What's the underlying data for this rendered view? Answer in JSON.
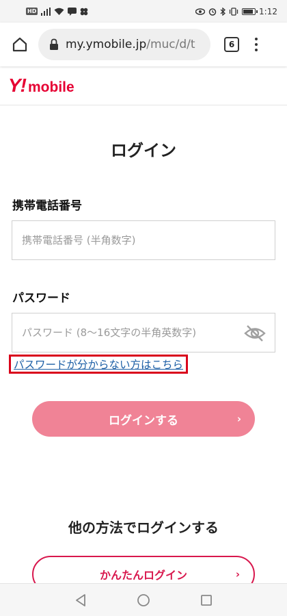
{
  "status_bar": {
    "hd": "HD",
    "time": "1:12",
    "battery_level": 0.75
  },
  "browser": {
    "url_domain": "my.ymobile.jp",
    "url_path": "/muc/d/t",
    "tab_count": "6"
  },
  "site": {
    "logo_mark": "Y!",
    "logo_text": "mobile"
  },
  "login": {
    "title": "ログイン",
    "phone_label": "携帯電話番号",
    "phone_placeholder": "携帯電話番号 (半角数字)",
    "password_label": "パスワード",
    "password_placeholder": "パスワード (8〜16文字の半角英数字)",
    "forgot_link": "パスワードが分からない方はこちら",
    "login_button": "ログインする",
    "chevron": "›"
  },
  "other": {
    "title": "他の方法でログインする",
    "easy_login_button": "かんたんログイン"
  },
  "colors": {
    "brand_red": "#e60033",
    "login_button_pink": "#f08396",
    "link_blue": "#1d5fa6",
    "highlight_red": "#d9001b"
  }
}
